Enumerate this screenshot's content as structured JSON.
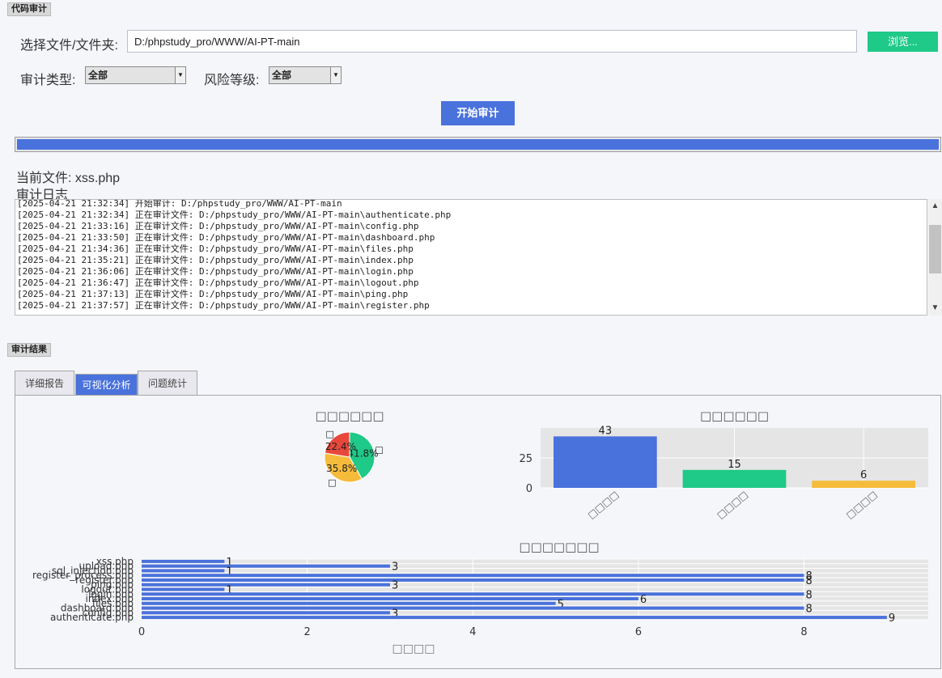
{
  "audit_group": {
    "title": "代码审计"
  },
  "file_select": {
    "label": "选择文件/文件夹:",
    "path_value": "D:/phpstudy_pro/WWW/AI-PT-main",
    "browse_label": "浏览..."
  },
  "filters": {
    "audit_type_label": "审计类型:",
    "audit_type_value": "全部",
    "risk_level_label": "风险等级:",
    "risk_level_value": "全部"
  },
  "start_button": {
    "label": "开始审计"
  },
  "progress": {
    "value_percent": 100,
    "color": "#4a72dc"
  },
  "current_file": {
    "text": "当前文件: xss.php"
  },
  "log": {
    "title": "审计日志",
    "lines": [
      "[2025-04-21 21:32:34] 开始审计: D:/phpstudy_pro/WWW/AI-PT-main",
      "[2025-04-21 21:32:34] 正在审计文件: D:/phpstudy_pro/WWW/AI-PT-main\\authenticate.php",
      "[2025-04-21 21:33:16] 正在审计文件: D:/phpstudy_pro/WWW/AI-PT-main\\config.php",
      "[2025-04-21 21:33:50] 正在审计文件: D:/phpstudy_pro/WWW/AI-PT-main\\dashboard.php",
      "[2025-04-21 21:34:36] 正在审计文件: D:/phpstudy_pro/WWW/AI-PT-main\\files.php",
      "[2025-04-21 21:35:21] 正在审计文件: D:/phpstudy_pro/WWW/AI-PT-main\\index.php",
      "[2025-04-21 21:36:06] 正在审计文件: D:/phpstudy_pro/WWW/AI-PT-main\\login.php",
      "[2025-04-21 21:36:47] 正在审计文件: D:/phpstudy_pro/WWW/AI-PT-main\\logout.php",
      "[2025-04-21 21:37:13] 正在审计文件: D:/phpstudy_pro/WWW/AI-PT-main\\ping.php",
      "[2025-04-21 21:37:57] 正在审计文件: D:/phpstudy_pro/WWW/AI-PT-main\\register.php"
    ]
  },
  "results_group": {
    "title": "审计结果"
  },
  "tabs": [
    {
      "label": "详细报告",
      "active": false
    },
    {
      "label": "可视化分析",
      "active": true
    },
    {
      "label": "问题统计",
      "active": false
    }
  ],
  "chart_data": [
    {
      "type": "pie",
      "title": "□□□□□□",
      "slices": [
        {
          "label": "□",
          "percent": 41.8,
          "pct_label": "41.8%",
          "color": "#1fc987"
        },
        {
          "label": "□",
          "percent": 35.8,
          "pct_label": "35.8%",
          "color": "#f5bc3c"
        },
        {
          "label": "□",
          "percent": 22.4,
          "pct_label": "22.4%",
          "color": "#e8483c"
        }
      ]
    },
    {
      "type": "bar",
      "title": "□□□□□□",
      "categories": [
        "□□□□",
        "□□□□",
        "□□□□"
      ],
      "values": [
        43,
        15,
        6
      ],
      "value_labels": [
        "43",
        "15",
        "6"
      ],
      "colors": [
        "#4a72dc",
        "#1fc987",
        "#f5bc3c"
      ],
      "ylim": [
        0,
        50
      ],
      "yticks": [
        "0",
        "25"
      ],
      "grid": true
    },
    {
      "type": "bar",
      "orientation": "horizontal",
      "title": "□□□□□□□",
      "xlabel": "□□□□",
      "categories": [
        "xss.php",
        "upload.php",
        "sql_injection.php",
        "register_process.php",
        "register.php",
        "ping.php",
        "logout.php",
        "login.php",
        "index.php",
        "files.php",
        "dashboard.php",
        "config.php",
        "authenticate.php"
      ],
      "values": [
        1,
        3,
        1,
        8,
        8,
        3,
        1,
        8,
        6,
        5,
        8,
        3,
        9
      ],
      "value_labels": [
        "1",
        "3",
        "1",
        "8",
        "8",
        "3",
        "1",
        "8",
        "6",
        "5",
        "8",
        "3",
        "9"
      ],
      "xlim": [
        0,
        9.5
      ],
      "xticks": [
        "0",
        "2",
        "4",
        "6",
        "8"
      ],
      "color": "#4a72dc",
      "grid": true
    }
  ]
}
